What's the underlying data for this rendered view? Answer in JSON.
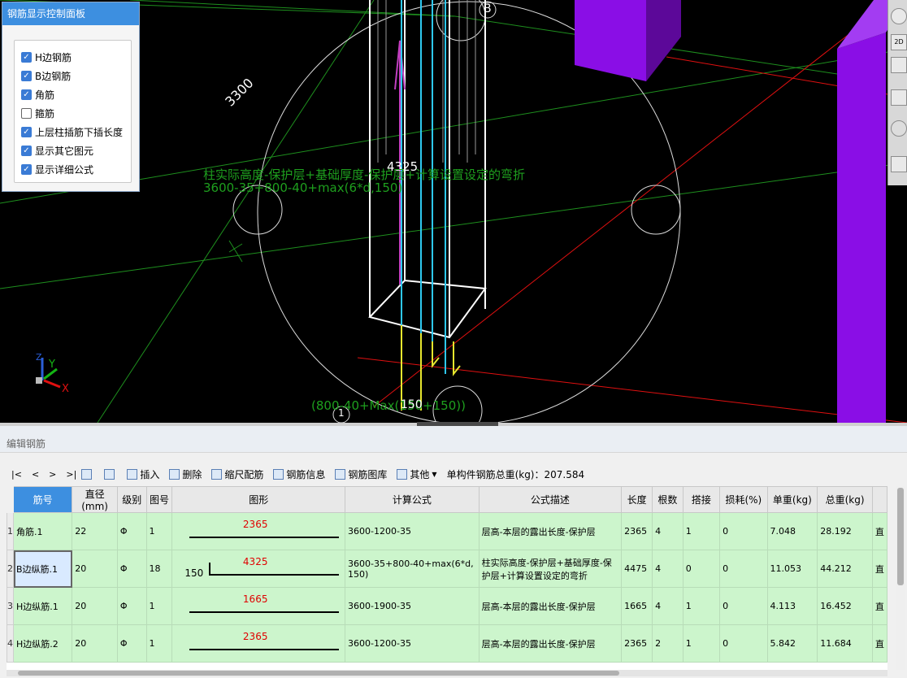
{
  "panel": {
    "title": "钢筋显示控制面板",
    "options": [
      {
        "label": "H边钢筋",
        "checked": true
      },
      {
        "label": "B边钢筋",
        "checked": true
      },
      {
        "label": "角筋",
        "checked": true
      },
      {
        "label": "箍筋",
        "checked": false
      },
      {
        "label": "上层柱插筋下插长度",
        "checked": true
      },
      {
        "label": "显示其它图元",
        "checked": true
      },
      {
        "label": "显示详细公式",
        "checked": true
      }
    ]
  },
  "viewport": {
    "dim_3300": "3300",
    "dim_4325": "4325",
    "formula_desc": "柱实际高度-保护层+基础厚度-保护层+计算设置设定的弯折",
    "formula_expr": "3600-35+800-40+max(6*d,150)",
    "bottom_formula": "(800-40+Max(150+150))",
    "bottom_150": "150",
    "axis_b": "B",
    "axis_1": "1",
    "axis_x": "X",
    "axis_y": "Y",
    "axis_z": "Z",
    "rtb_2d": "2D"
  },
  "editor": {
    "title": "编辑钢筋",
    "nav": [
      "|<",
      "<",
      ">",
      ">|"
    ],
    "tools": [
      "插入",
      "删除",
      "缩尺配筋",
      "钢筋信息",
      "钢筋图库",
      "其他"
    ],
    "total_weight": "单构件钢筋总重(kg)：207.584",
    "columns": [
      "筋号",
      "直径(mm)",
      "级别",
      "图号",
      "图形",
      "计算公式",
      "公式描述",
      "长度",
      "根数",
      "搭接",
      "损耗(%)",
      "单重(kg)",
      "总重(kg)",
      ""
    ],
    "rows": [
      {
        "num": "1",
        "name": "角筋.1",
        "dia": "22",
        "grade": "Φ",
        "fig": "1",
        "shape_left": "",
        "shape_val": "2365",
        "formula": "3600-1200-35",
        "desc": "层高-本层的露出长度-保护层",
        "len": "2365",
        "count": "4",
        "lap": "1",
        "loss": "0",
        "unit_w": "7.048",
        "total_w": "28.192",
        "extra": "直"
      },
      {
        "num": "2",
        "name": "B边纵筋.1",
        "dia": "20",
        "grade": "Φ",
        "fig": "18",
        "shape_left": "150",
        "shape_val": "4325",
        "formula": "3600-35+800-40+max(6*d, 150)",
        "desc": "柱实际高度-保护层+基础厚度-保护层+计算设置设定的弯折",
        "len": "4475",
        "count": "4",
        "lap": "0",
        "loss": "0",
        "unit_w": "11.053",
        "total_w": "44.212",
        "extra": "直"
      },
      {
        "num": "3",
        "name": "H边纵筋.1",
        "dia": "20",
        "grade": "Φ",
        "fig": "1",
        "shape_left": "",
        "shape_val": "1665",
        "formula": "3600-1900-35",
        "desc": "层高-本层的露出长度-保护层",
        "len": "1665",
        "count": "4",
        "lap": "1",
        "loss": "0",
        "unit_w": "4.113",
        "total_w": "16.452",
        "extra": "直"
      },
      {
        "num": "4",
        "name": "H边纵筋.2",
        "dia": "20",
        "grade": "Φ",
        "fig": "1",
        "shape_left": "",
        "shape_val": "2365",
        "formula": "3600-1200-35",
        "desc": "层高-本层的露出长度-保护层",
        "len": "2365",
        "count": "2",
        "lap": "1",
        "loss": "0",
        "unit_w": "5.842",
        "total_w": "11.684",
        "extra": "直"
      }
    ]
  }
}
